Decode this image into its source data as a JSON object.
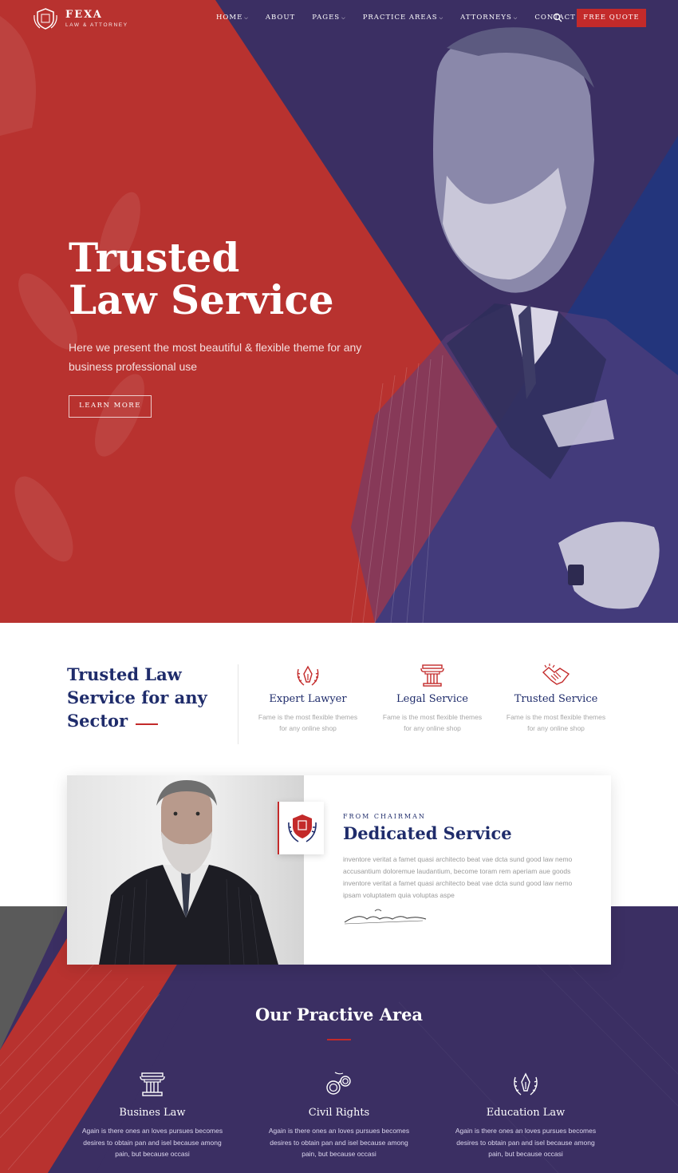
{
  "brand": {
    "name": "FEXA",
    "tagline": "LAW & ATTORNEY"
  },
  "nav": {
    "items": [
      {
        "label": "HOME",
        "has_dropdown": true
      },
      {
        "label": "ABOUT",
        "has_dropdown": false
      },
      {
        "label": "PAGES",
        "has_dropdown": true
      },
      {
        "label": "PRACTICE AREAS",
        "has_dropdown": true
      },
      {
        "label": "ATTORNEYS",
        "has_dropdown": true
      },
      {
        "label": "CONTACT",
        "has_dropdown": false
      }
    ],
    "quote_button": "FREE QUOTE",
    "icons": {
      "search": "search-icon",
      "dropdown": "chevron-down-icon"
    }
  },
  "hero": {
    "title_line1": "Trusted",
    "title_line2": "Law Service",
    "subtitle": "Here we present the most beautiful & flexible theme for any business professional use",
    "button": "LEARN MORE"
  },
  "features": {
    "heading_line1": "Trusted Law",
    "heading_line2": "Service for any",
    "heading_line3": "Sector",
    "items": [
      {
        "icon": "pen-laurel-icon",
        "title": "Expert Lawyer",
        "desc_line1": "Fame is the most flexible themes",
        "desc_line2": "for any online shop"
      },
      {
        "icon": "pillar-icon",
        "title": "Legal Service",
        "desc_line1": "Fame is the most flexible themes",
        "desc_line2": "for any online shop"
      },
      {
        "icon": "handshake-icon",
        "title": "Trusted Service",
        "desc_line1": "Fame is the most flexible themes",
        "desc_line2": "for any online shop"
      }
    ]
  },
  "chairman": {
    "kicker": "FROM CHAIRMAN",
    "title": "Dedicated Service",
    "text": "inventore veritat a famet quasi architecto beat vae dcta sund good law nemo accusantium doloremue laudantium, become toram rem aperiam aue goods inventore veritat a famet quasi architecto beat vae dcta sund good law nemo ipsam voluptatem quia voluptas aspe"
  },
  "practice": {
    "heading": "Our Practive Area",
    "items": [
      {
        "icon": "pillar-icon",
        "title": "Busines Law",
        "desc_line1": "Again is there ones an loves pursues becomes",
        "desc_line2": "desires to obtain pan and isel because among",
        "desc_line3": "pain, but because occasi"
      },
      {
        "icon": "handcuffs-icon",
        "title": "Civil Rights",
        "desc_line1": "Again is there ones an loves pursues becomes",
        "desc_line2": "desires to obtain pan and isel because among",
        "desc_line3": "pain, but because occasi"
      },
      {
        "icon": "pen-laurel-icon",
        "title": "Education Law",
        "desc_line1": "Again is there ones an loves pursues becomes",
        "desc_line2": "desires to obtain pan and isel because among",
        "desc_line3": "pain, but because occasi"
      }
    ]
  },
  "colors": {
    "red": "#b8322f",
    "navy": "#3b2f63",
    "blue": "#23357c",
    "accent": "#c32a2a",
    "heading": "#1f2c6b"
  }
}
